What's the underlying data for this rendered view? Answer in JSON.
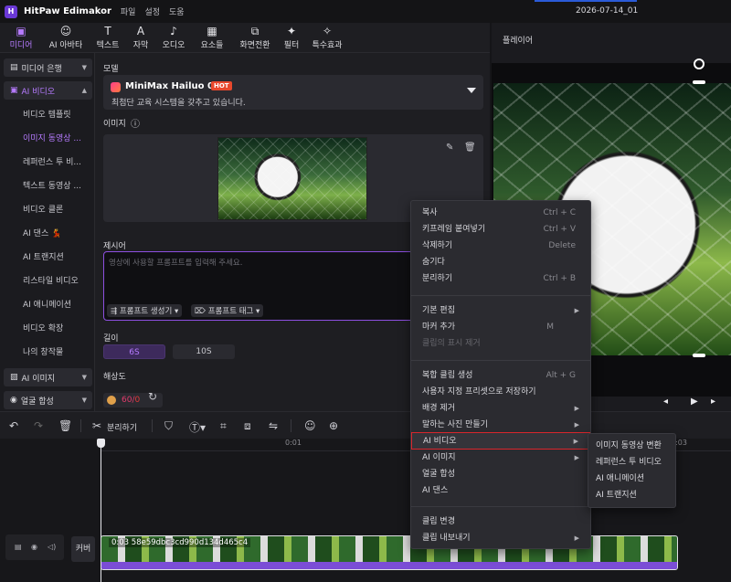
{
  "app": {
    "title": "HitPaw Edimakor",
    "menu": [
      "파일",
      "설정",
      "도움"
    ],
    "project_name": "2026-07-14_01"
  },
  "toolbar": {
    "items": [
      {
        "label": "미디어",
        "icon": "media-icon"
      },
      {
        "label": "AI 아바타",
        "icon": "avatar-icon"
      },
      {
        "label": "텍스트",
        "icon": "text-icon"
      },
      {
        "label": "자막",
        "icon": "subtitle-icon"
      },
      {
        "label": "오디오",
        "icon": "audio-icon"
      },
      {
        "label": "요소들",
        "icon": "elements-icon"
      },
      {
        "label": "화면전환",
        "icon": "transition-icon"
      },
      {
        "label": "필터",
        "icon": "filter-icon"
      },
      {
        "label": "특수효과",
        "icon": "effects-icon"
      }
    ],
    "active_index": 0
  },
  "sidebar": {
    "groups": [
      {
        "label": "미디어 은행"
      },
      {
        "label": "AI 비디오"
      },
      {
        "label": "AI 이미지"
      },
      {
        "label": "얼굴 합성"
      }
    ],
    "items": [
      {
        "label": "비디오 템플릿"
      },
      {
        "label": "이미지 동영상 ..."
      },
      {
        "label": "레퍼런스 투 비..."
      },
      {
        "label": "텍스트 동영상 ..."
      },
      {
        "label": "비디오 클론"
      },
      {
        "label": "AI 댄스 💃"
      },
      {
        "label": "AI 트랜지션"
      },
      {
        "label": "리스타일 비디오"
      },
      {
        "label": "AI 애니메이션"
      },
      {
        "label": "비디오 확장"
      },
      {
        "label": "나의 창작물"
      }
    ],
    "active_item": 1
  },
  "panel": {
    "model_label": "모델",
    "model_name": "MiniMax Hailuo 02",
    "model_badge": "HOT",
    "model_desc": "최첨단 교육 시스템을 갖추고 있습니다.",
    "image_label": "이미지",
    "prompt_label": "제시어",
    "prompt_placeholder": "영상에 사용할 프롬프트를 입력해 주세요.",
    "prompt_gen_button": "프롬프트 생성기",
    "prompt_tag_button": "프롬프트 태그",
    "length_label": "길이",
    "length_options": [
      "6S",
      "10S"
    ],
    "length_selected": 0,
    "resolution_label": "해상도",
    "credit_value": "60",
    "credit_cost": "0"
  },
  "player": {
    "title": "플레이어"
  },
  "timeline_toolbar": {
    "split_label": "분리하기"
  },
  "timeline": {
    "ruler_labels": [
      "0:01",
      "0:03"
    ],
    "cover_label": "커버",
    "clip_label": "0:03 58e59dbc3cd990d134d465c4"
  },
  "context_menu": {
    "items": [
      {
        "label": "복사",
        "shortcut": "Ctrl + C"
      },
      {
        "label": "키프레임 붙여넣기",
        "shortcut": "Ctrl + V"
      },
      {
        "label": "삭제하기",
        "shortcut": "Delete"
      },
      {
        "label": "숨기다",
        "shortcut": ""
      },
      {
        "label": "분리하기",
        "shortcut": "Ctrl + B"
      },
      {
        "label": "기본 편집",
        "shortcut": ""
      },
      {
        "label": "마커 추가",
        "shortcut": "M"
      },
      {
        "label": "클립의 표시 제거",
        "shortcut": ""
      },
      {
        "label": "복합 클립 생성",
        "shortcut": "Alt + G"
      },
      {
        "label": "사용자 지정 프리셋으로 저장하기",
        "shortcut": ""
      },
      {
        "label": "배경 제거",
        "shortcut": ""
      },
      {
        "label": "말하는 사진 만들기",
        "shortcut": ""
      },
      {
        "label": "AI 비디오",
        "shortcut": ""
      },
      {
        "label": "AI 이미지",
        "shortcut": ""
      },
      {
        "label": "얼굴 합성",
        "shortcut": ""
      },
      {
        "label": "AI 댄스",
        "shortcut": ""
      },
      {
        "label": "클립 변경",
        "shortcut": ""
      },
      {
        "label": "클립 내보내기",
        "shortcut": ""
      }
    ],
    "highlighted_index": 12
  },
  "submenu": {
    "items": [
      {
        "label": "이미지 동영상 변환"
      },
      {
        "label": "레퍼런스 투 비디오"
      },
      {
        "label": "AI 애니메이션"
      },
      {
        "label": "AI 트랜지션"
      }
    ]
  },
  "colors": {
    "accent": "#b67bff",
    "highlight_border": "#d8262c",
    "clip_bar": "#7b4dd6",
    "hot_badge": "#e8482c"
  }
}
